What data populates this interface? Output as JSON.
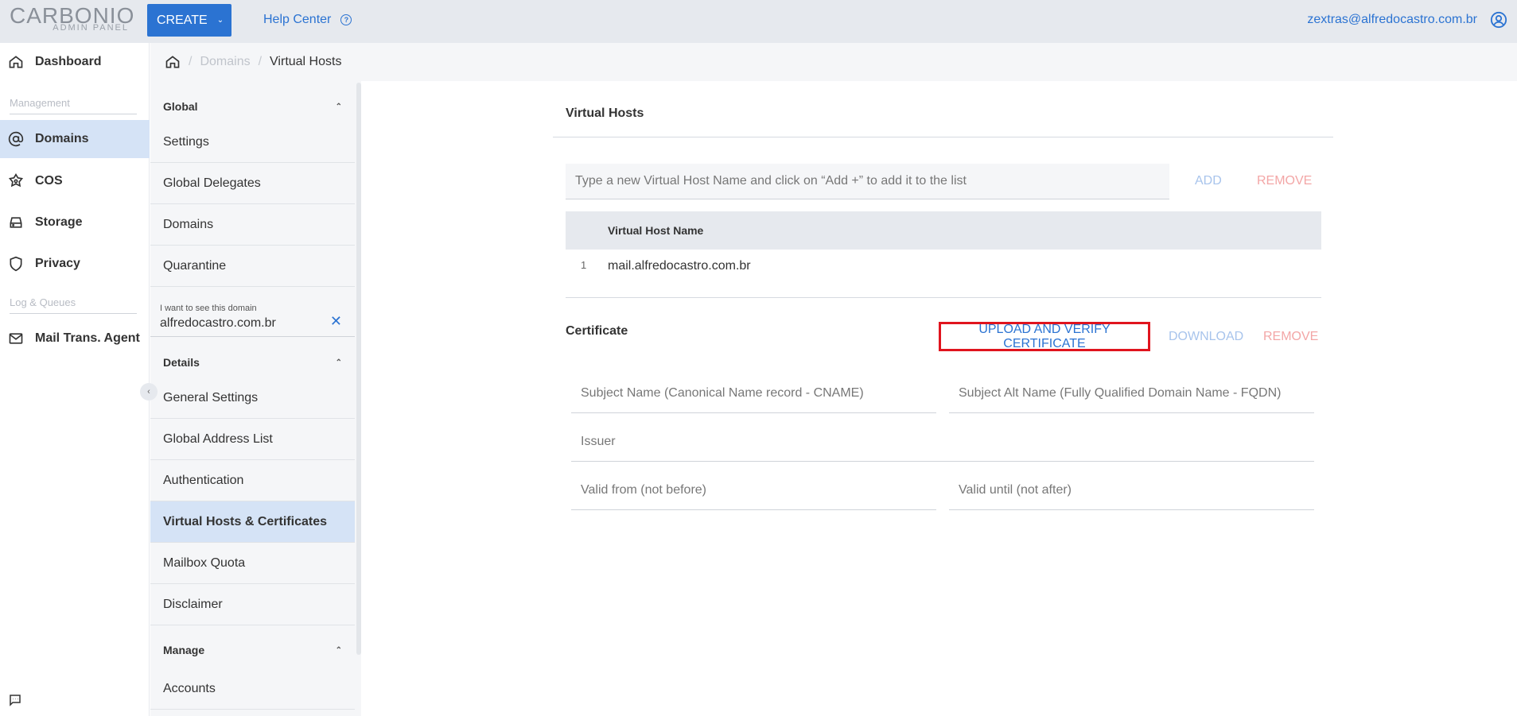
{
  "brand": {
    "name": "CARBONIO",
    "sub": "ADMIN PANEL"
  },
  "topbar": {
    "create_label": "CREATE",
    "help_label": "Help Center",
    "user_email": "zextras@alfredocastro.com.br"
  },
  "leftnav": {
    "dashboard": "Dashboard",
    "management_section": "Management",
    "domains": "Domains",
    "cos": "COS",
    "storage": "Storage",
    "privacy": "Privacy",
    "logs_section": "Log & Queues",
    "mta": "Mail Trans. Agent"
  },
  "breadcrumb": {
    "domains": "Domains",
    "current": "Virtual Hosts"
  },
  "subnav": {
    "global_head": "Global",
    "global_items": [
      "Settings",
      "Global Delegates",
      "Domains",
      "Quarantine"
    ],
    "domain_label": "I want to see this domain",
    "domain_value": "alfredocastro.com.br",
    "details_head": "Details",
    "details_items": [
      "General Settings",
      "Global Address List",
      "Authentication",
      "Virtual Hosts & Certificates",
      "Mailbox Quota",
      "Disclaimer"
    ],
    "manage_head": "Manage",
    "manage_items": [
      "Accounts"
    ]
  },
  "main": {
    "title": "Virtual Hosts",
    "input_placeholder": "Type a new Virtual Host Name and click on “Add +” to add it to the list",
    "add_label": "ADD",
    "remove_label": "REMOVE",
    "table_header": "Virtual Host Name",
    "rows": [
      {
        "index": "1",
        "name": "mail.alfredocastro.com.br"
      }
    ],
    "certificate_title": "Certificate",
    "upload_label": "UPLOAD AND VERIFY CERTIFICATE",
    "download_label": "DOWNLOAD",
    "cert_remove_label": "REMOVE",
    "fields": {
      "subject": "Subject Name (Canonical Name record - CNAME)",
      "alt": "Subject Alt Name (Fully Qualified Domain Name - FQDN)",
      "issuer": "Issuer",
      "valid_from": "Valid from (not before)",
      "valid_until": "Valid until (not after)"
    }
  },
  "colors": {
    "accent": "#2b73d2",
    "active_bg": "#d5e3f6",
    "danger": "#f3a6a6",
    "highlight_border": "#e0141e"
  }
}
